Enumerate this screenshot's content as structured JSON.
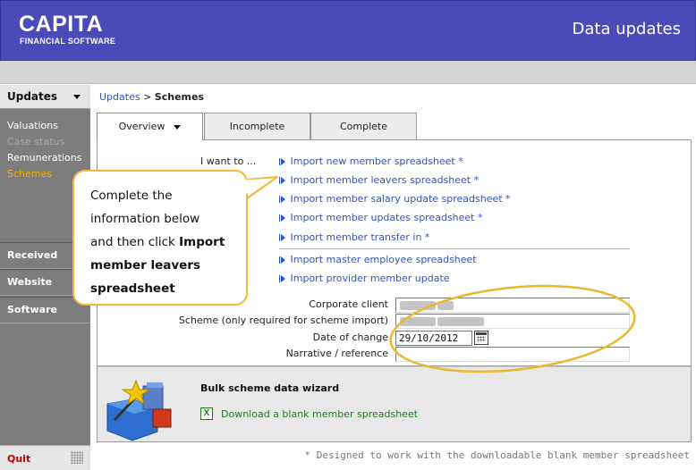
{
  "header": {
    "logo": "CAPITA",
    "logo_sub": "FINANCIAL SOFTWARE",
    "title": "Data updates"
  },
  "sidebar": {
    "head": "Updates",
    "sub_items": [
      "Valuations",
      "Case status",
      "Remunerations",
      "Schemes"
    ],
    "sections": [
      "Received",
      "Website",
      "Software"
    ],
    "quit": "Quit"
  },
  "breadcrumb": {
    "link": "Updates",
    "sep": " > ",
    "current": "Schemes"
  },
  "tabs": [
    "Overview",
    "Incomplete",
    "Complete"
  ],
  "i_want_to": "I want to ...",
  "links": [
    "Import new member spreadsheet *",
    "Import member leavers spreadsheet *",
    "Import member salary update spreadsheet *",
    "Import member updates spreadsheet *",
    "Import member transfer in *",
    "Import master employee spreadsheet",
    "Import provider member update"
  ],
  "form": {
    "corporate_client_label": "Corporate client",
    "scheme_label": "Scheme (only required for scheme import)",
    "date_label": "Date of change",
    "date_value": "29/10/2012",
    "narrative_label": "Narrative / reference"
  },
  "wizard": {
    "title": "Bulk scheme data wizard",
    "link": "Download a blank member spreadsheet",
    "excel_glyph": "X"
  },
  "footnote": "* Designed to work with the downloadable blank member spreadsheet",
  "callout": {
    "line1": "Complete the",
    "line2": "information below",
    "line3": "and then click ",
    "bold1": "Import",
    "bold2": "member leavers",
    "bold3": "spreadsheet"
  },
  "colors": {
    "header_bg": "#4a4ab8",
    "sidebar_bg": "#7d7d7d",
    "link": "#3355bb",
    "callout_border": "#f0b93a",
    "highlight_ellipse": "#e8b830",
    "active_nav": "#f4b400",
    "quit": "#c00000"
  }
}
